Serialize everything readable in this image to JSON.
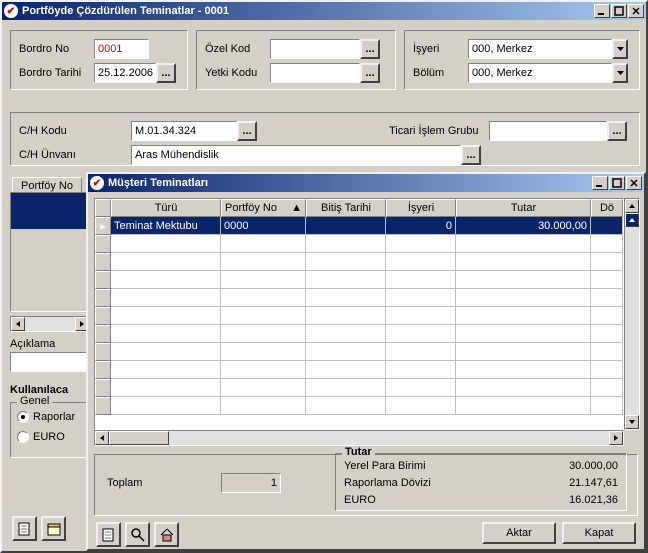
{
  "main": {
    "title": "Portföyde Çözdürülen Teminatlar - 0001",
    "p1": {
      "bordro_no_lbl": "Bordro No",
      "bordro_no": "0001",
      "bordro_tarihi_lbl": "Bordro Tarihi",
      "bordro_tarihi": "25.12.2006"
    },
    "p2": {
      "ozel_kod_lbl": "Özel Kod",
      "ozel_kod": "",
      "yetki_kodu_lbl": "Yetki Kodu",
      "yetki_kodu": ""
    },
    "p3": {
      "isyeri_lbl": "İşyeri",
      "isyeri": "000, Merkez",
      "bolum_lbl": "Bölüm",
      "bolum": "000, Merkez"
    },
    "p4": {
      "ch_kodu_lbl": "C/H Kodu",
      "ch_kodu": "M.01.34.324",
      "ch_unvani_lbl": "C/H Ünvanı",
      "ch_unvani": "Aras Mühendislik",
      "ticari_islem_lbl": "Ticari İşlem Grubu",
      "ticari_islem": ""
    },
    "tab": "Portföy No",
    "aciklama_lbl": "Açıklama",
    "kullanilaca_lbl": "Kullanılaca",
    "genel_lbl": "Genel",
    "raporlar_lbl": "Raporlar",
    "euro_lbl": "EURO"
  },
  "sub": {
    "title": "Müşteri Teminatları",
    "columns": [
      "Türü",
      "Portföy No",
      "Bitiş Tarihi",
      "İşyeri",
      "Tutar",
      "Dö"
    ],
    "row": {
      "turu": "Teminat Mektubu",
      "portfoy": "0000",
      "bitis": "",
      "isyeri": "0",
      "tutar": "30.000,00",
      "do": ""
    },
    "toplam_lbl": "Toplam",
    "toplam": "1",
    "tutar_box": {
      "title": "Tutar",
      "yerel_lbl": "Yerel Para Birimi",
      "yerel": "30.000,00",
      "rapor_lbl": "Raporlama Dövizi",
      "rapor": "21.147,61",
      "euro_lbl": "EURO",
      "euro": "16.021,36"
    },
    "btn_aktar": "Aktar",
    "btn_kapat": "Kapat"
  }
}
